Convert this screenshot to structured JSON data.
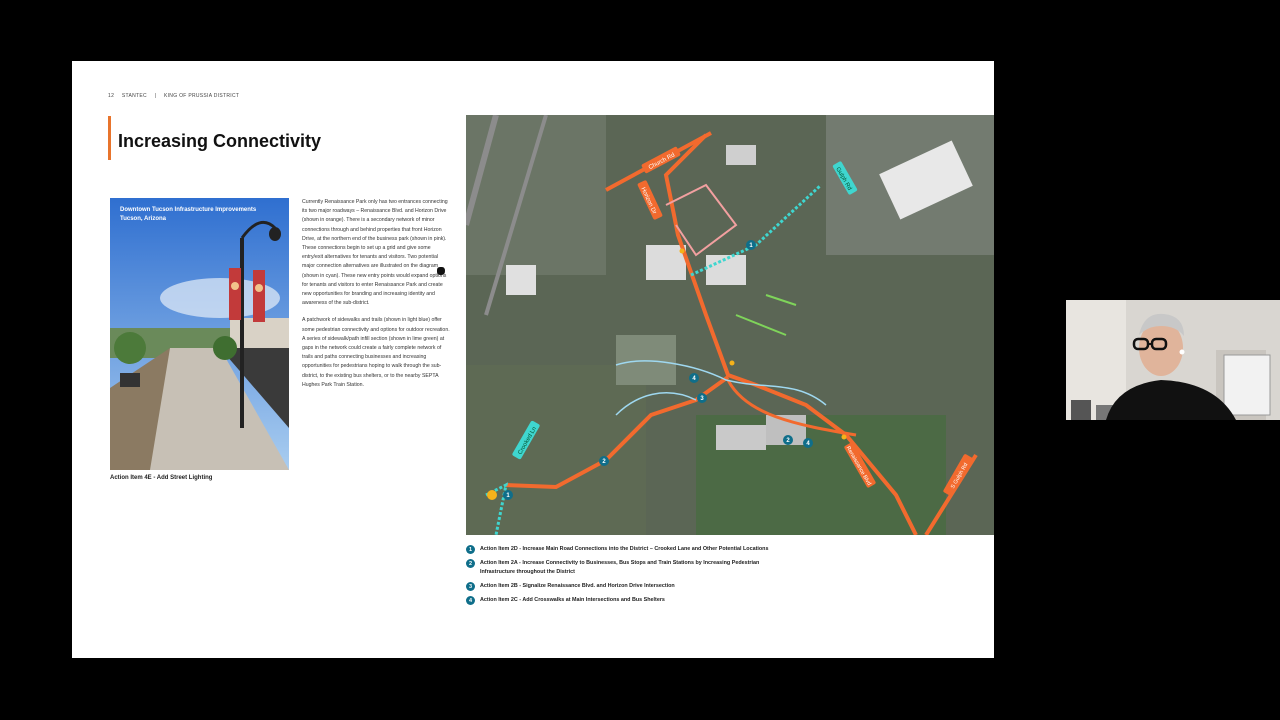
{
  "header": {
    "page_number": "12",
    "brand": "STANTEC",
    "district": "KING OF PRUSSIA DISTRICT"
  },
  "slide": {
    "title": "Increasing Connectivity",
    "photo_title_line1": "Downtown Tucson Infrastructure Improvements",
    "photo_title_line2": "Tucson, Arizona",
    "photo_caption": "Action Item 4E - Add Street Lighting",
    "paragraph1": "Currently Renaissance Park only has two entrances connecting its two major roadways – Renaissance Blvd. and Horizon Drive (shown in orange). There is a secondary network of minor connections through and behind properties that front Horizon Drive, at the northern end of the business park (shown in pink). These connections begin to set up a grid and give some entry/exit alternatives for tenants and visitors. Two potential major connection alternatives are illustrated on the diagram (shown in cyan). These new entry points would expand options for tenants and visitors to enter Renaissance Park and create new opportunities for branding and increasing identity and awareness of the sub-district.",
    "paragraph2": "A patchwork of sidewalks and trails (shown in light blue) offer some pedestrian connectivity and options for outdoor recreation. A series of sidewalk/path infill section (shown in lime green) at gaps in the network could create a fairly complete network of trails and paths connecting businesses and increasing opportunities for pedestrians hoping to walk through the sub-district, to the existing bus shelters, or to the nearby SEPTA Hughes Park Train Station."
  },
  "map": {
    "labels": {
      "church_rd": "Church Rd",
      "horizon_dr": "Horizon Dr",
      "crooked_ln": "Crooked Ln",
      "renaissance_blvd": "Renaissance Blvd",
      "gulph_rd": "Gulph Rd",
      "south_gulph": "S Gulph Rd"
    },
    "colors": {
      "road_orange": "#f26a2e",
      "connection_cyan": "#3fd6cf",
      "minor_pink": "#f2a0a0",
      "trail_blue": "#9fd8f0",
      "infill_lime": "#7fd45a",
      "marker": "#0f6e8a"
    }
  },
  "legend": [
    {
      "num": "1",
      "text": "Action Item 2D - Increase Main Road Connections into the District – Crooked Lane and Other Potential Locations"
    },
    {
      "num": "2",
      "text": "Action Item 2A - Increase Connectivity to Businesses, Bus Stops and Train Stations by Increasing Pedestrian Infrastructure throughout the District"
    },
    {
      "num": "3",
      "text": "Action Item 2B - Signalize Renaissance Blvd. and Horizon Drive Intersection"
    },
    {
      "num": "4",
      "text": "Action Item 2C - Add Crosswalks at Main Intersections and Bus Shelters"
    }
  ]
}
